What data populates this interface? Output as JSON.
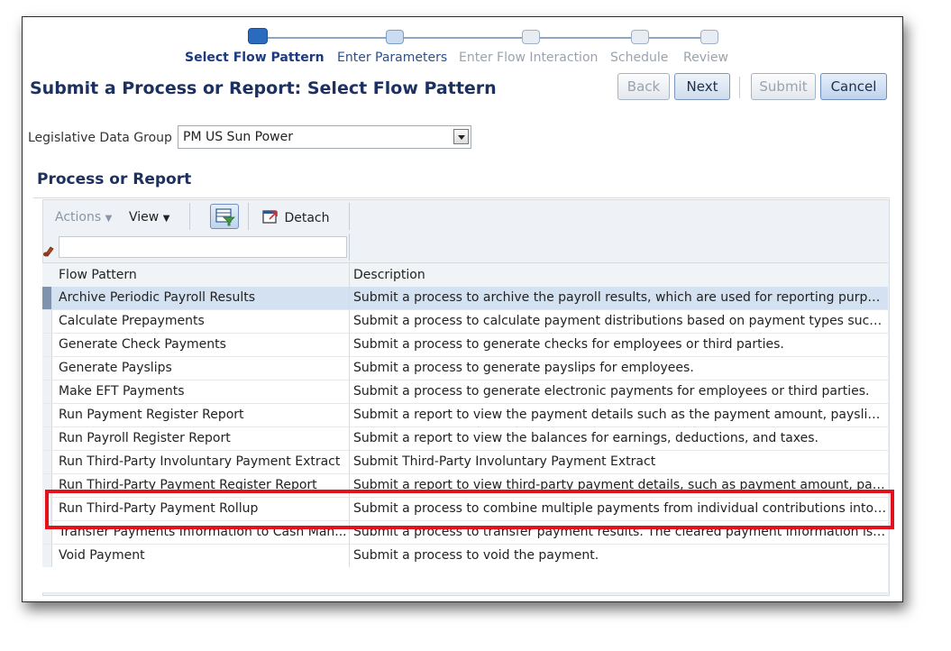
{
  "train": {
    "steps": [
      {
        "label": "Select Flow Pattern",
        "state": "active"
      },
      {
        "label": "Enter Parameters",
        "state": "next"
      },
      {
        "label": "Enter Flow Interaction",
        "state": "disabled"
      },
      {
        "label": "Schedule",
        "state": "disabled"
      },
      {
        "label": "Review",
        "state": "disabled"
      }
    ]
  },
  "header": {
    "title": "Submit a Process or Report: Select Flow Pattern",
    "back_label": "Back",
    "next_label": "Next",
    "submit_label": "Submit",
    "cancel_label": "Cancel"
  },
  "form": {
    "ldg_label": "Legislative Data Group",
    "ldg_value": "PM US Sun Power"
  },
  "section": {
    "title": "Process or Report"
  },
  "toolbar": {
    "actions_label": "Actions",
    "view_label": "View",
    "detach_label": "Detach"
  },
  "table": {
    "columns": [
      "Flow Pattern",
      "Description"
    ],
    "rows": [
      {
        "flow": "Archive Periodic Payroll Results",
        "desc": "Submit a process to archive the payroll results, which are used for reporting purpos..."
      },
      {
        "flow": "Calculate Prepayments",
        "desc": "Submit a process to calculate payment distributions based on payment types such a..."
      },
      {
        "flow": "Generate Check Payments",
        "desc": "Submit a process to generate checks for employees or third parties."
      },
      {
        "flow": "Generate Payslips",
        "desc": "Submit a process to generate payslips for employees."
      },
      {
        "flow": "Make EFT Payments",
        "desc": "Submit a process to generate electronic payments for employees or third parties."
      },
      {
        "flow": "Run Payment Register Report",
        "desc": "Submit a report to view the payment details such as the payment amount, payslip a..."
      },
      {
        "flow": "Run Payroll Register Report",
        "desc": "Submit a report to view the balances for earnings, deductions, and taxes."
      },
      {
        "flow": "Run Third-Party Involuntary Payment Extract",
        "desc": "Submit Third-Party Involuntary Payment Extract"
      },
      {
        "flow": "Run Third-Party Payment Register Report",
        "desc": "Submit a report to view third-party payment details, such as payment amount, pay..."
      },
      {
        "flow": "Run Third-Party Payment Rollup",
        "desc": "Submit a process to combine multiple payments from individual contributions into a s..."
      },
      {
        "flow": "Transfer Payments Information to Cash Man...",
        "desc": "Submit a process to transfer payment results. The cleared payment information is u..."
      },
      {
        "flow": "Void Payment",
        "desc": "Submit a process to void the payment."
      }
    ],
    "selected_index": 0,
    "highlighted_index": 9
  },
  "colors": {
    "title": "#1c3160",
    "selected_row": "#d4e1f1",
    "highlight_box": "#e3111b"
  }
}
